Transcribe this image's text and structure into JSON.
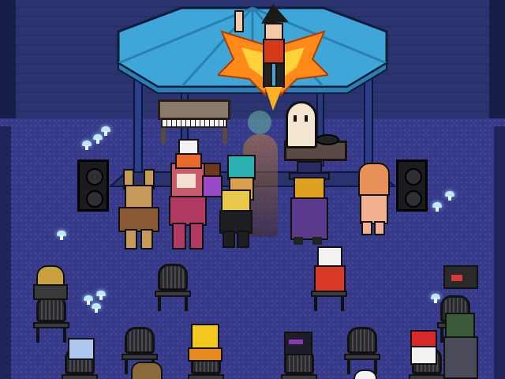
{
  "scene": {
    "type": "game-scene",
    "colors": {
      "wall": "#28306a",
      "wall_shadow": "#1a2050",
      "floor": "#3a3c8c",
      "gazebo_roof": "#3fa6d8",
      "gazebo_roof_dark": "#2a7fb3",
      "gazebo_post": "#2c3f8a",
      "piano": "#8a7a6a",
      "mushroom_glow": "#bfe8ff",
      "flame": "#ff8a1a",
      "chair": "#3a3a40"
    },
    "icons": [
      "gazebo-roof",
      "piano",
      "speaker",
      "glowing-mushroom",
      "folding-chair",
      "flame-wings"
    ]
  }
}
